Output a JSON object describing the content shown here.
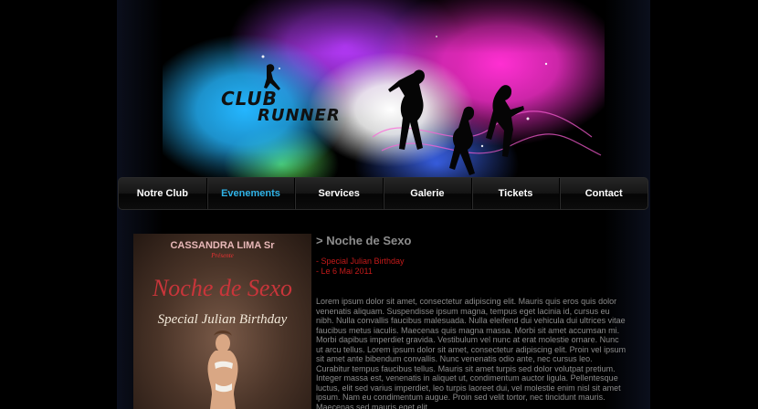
{
  "logo": {
    "line1": "CLUB",
    "line2": "RUNNER"
  },
  "nav": {
    "items": [
      {
        "label": "Notre Club"
      },
      {
        "label": "Evenements"
      },
      {
        "label": "Services"
      },
      {
        "label": "Galerie"
      },
      {
        "label": "Tickets"
      },
      {
        "label": "Contact"
      }
    ],
    "active_index": 1
  },
  "poster": {
    "headline": "CASSANDRA LIMA Sr",
    "presents": "Présente",
    "title": "Noche de Sexo",
    "subtitle": "Special Julian Birthday"
  },
  "article": {
    "title": "> Noche de Sexo",
    "meta": [
      "- Special Julian Birthday",
      "- Le 6 Mai 2011"
    ],
    "body": "Lorem ipsum dolor sit amet, consectetur adipiscing elit. Mauris quis eros quis dolor venenatis aliquam. Suspendisse ipsum magna, tempus eget lacinia id, cursus eu nibh. Nulla convallis faucibus malesuada. Nulla eleifend dui vehicula dui ultrices vitae faucibus metus iaculis. Maecenas quis magna massa. Morbi sit amet accumsan mi. Morbi dapibus imperdiet gravida. Vestibulum vel nunc at erat molestie ornare. Nunc ut arcu tellus. Lorem ipsum dolor sit amet, consectetur adipiscing elit. Proin vel ipsum sit amet ante bibendum convallis. Nunc venenatis odio ante, nec cursus leo. Curabitur tempus faucibus tellus. Mauris sit amet turpis sed dolor volutpat pretium. Integer massa est, venenatis in aliquet ut, condimentum auctor ligula. Pellentesque luctus, elit sed varius imperdiet, leo turpis laoreet dui, vel molestie enim nisl sit amet ipsum. Nam eu condimentum augue. Proin sed velit tortor, nec tincidunt mauris. Maecenas sed mauris eget elit"
  },
  "colors": {
    "accent": "#2fb2e6",
    "meta_red": "#c41a1a",
    "text_gray": "#8b8b8b"
  }
}
